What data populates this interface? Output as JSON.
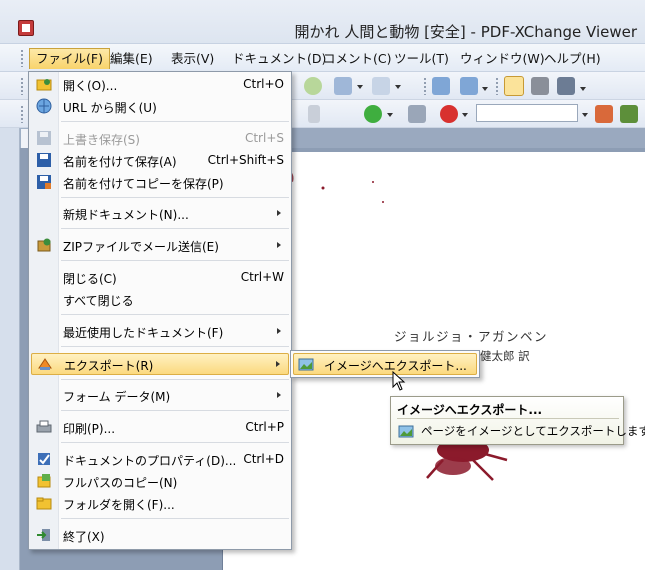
{
  "window": {
    "title": "開かれ 人間と動物 [安全] - PDF-XChange Viewer"
  },
  "menubar": {
    "items": [
      {
        "label": "ファイル(F)",
        "active": true
      },
      {
        "label": "編集(E)"
      },
      {
        "label": "表示(V)"
      },
      {
        "label": "ドキュメント(D)"
      },
      {
        "label": "コメント(C)"
      },
      {
        "label": "ツール(T)"
      },
      {
        "label": "ウィンドウ(W)"
      },
      {
        "label": "ヘルプ(H)"
      }
    ]
  },
  "file_menu": {
    "items": [
      {
        "label": "開く(O)...",
        "shortcut": "Ctrl+O",
        "icon": "open-folder-icon"
      },
      {
        "label": "URL から開く(U)",
        "icon": "globe-icon"
      },
      {
        "label": "上書き保存(S)",
        "shortcut": "Ctrl+S",
        "disabled": true,
        "icon": "save-disk-icon"
      },
      {
        "label": "名前を付けて保存(A)",
        "shortcut": "Ctrl+Shift+S",
        "icon": "save-as-icon"
      },
      {
        "label": "名前を付けてコピーを保存(P)",
        "icon": "save-copy-icon"
      },
      {
        "label": "新規ドキュメント(N)...",
        "submenu": true
      },
      {
        "label": "ZIPファイルでメール送信(E)",
        "submenu": true,
        "icon": "zip-mail-icon"
      },
      {
        "label": "閉じる(C)",
        "shortcut": "Ctrl+W"
      },
      {
        "label": "すべて閉じる"
      },
      {
        "label": "最近使用したドキュメント(F)",
        "submenu": true
      },
      {
        "label": "エクスポート(R)",
        "submenu": true,
        "highlighted": true,
        "icon": "export-icon"
      },
      {
        "label": "フォーム データ(M)",
        "submenu": true
      },
      {
        "label": "印刷(P)...",
        "shortcut": "Ctrl+P",
        "icon": "printer-icon"
      },
      {
        "label": "ドキュメントのプロパティ(D)...",
        "shortcut": "Ctrl+D",
        "icon": "properties-icon"
      },
      {
        "label": "フルパスのコピー(N)",
        "icon": "copy-path-icon"
      },
      {
        "label": "フォルダを開く(F)...",
        "icon": "folder-icon"
      },
      {
        "label": "終了(X)",
        "icon": "exit-icon"
      }
    ]
  },
  "export_submenu": {
    "items": [
      {
        "label": "イメージへエクスポート...",
        "icon": "export-image-icon"
      }
    ]
  },
  "tooltip": {
    "title": "イメージへエクスポート...",
    "description": "ページをイメージとしてエクスポートします..."
  },
  "document": {
    "author": "ジョルジョ・アガンベン",
    "translator": "健太郎 訳"
  },
  "colors": {
    "menu_highlight": "#fbd97f",
    "titlebar": "#dde5f0",
    "doc_background": "#8d9db4",
    "illustration": "#8b1a2b"
  }
}
